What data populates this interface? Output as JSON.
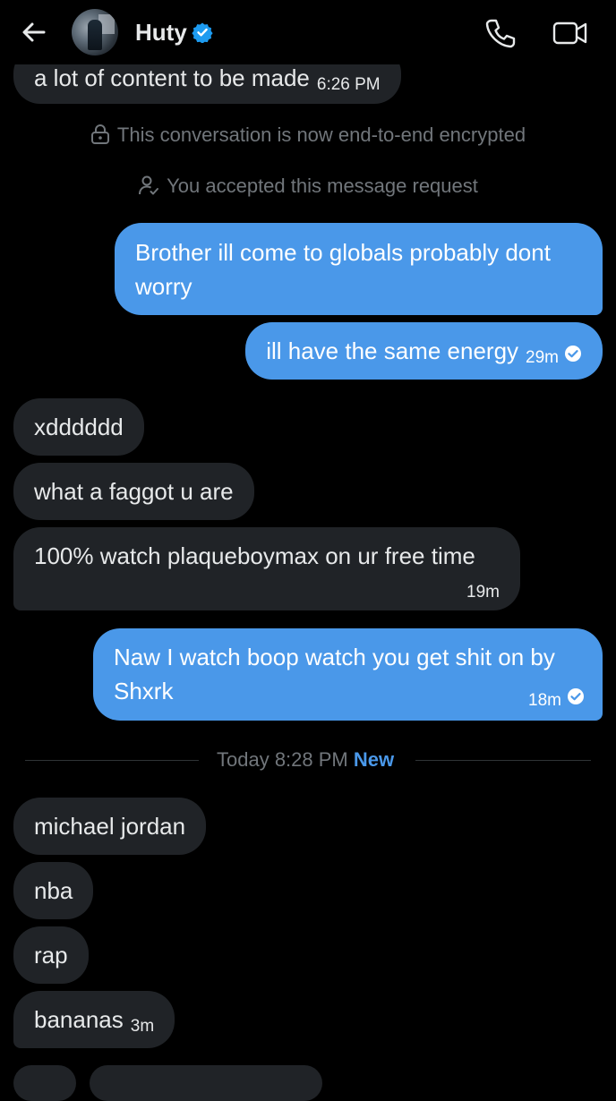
{
  "header": {
    "username": "Huty",
    "verified": true,
    "icons": [
      "back-arrow-icon",
      "verified-badge-icon",
      "phone-icon",
      "video-camera-icon"
    ]
  },
  "colors": {
    "background": "#000000",
    "incoming_bubble": "#202327",
    "outgoing_bubble": "#4a98e9",
    "muted_text": "#71767b",
    "accent": "#4a98e9"
  },
  "messages": {
    "m1": {
      "text": "a lot of content to be made",
      "time": "6:26 PM"
    },
    "sys_encrypted": "This conversation is now end-to-end encrypted",
    "sys_accepted": "You accepted this message request",
    "m2": {
      "text": "Brother ill come to globals probably dont worry"
    },
    "m3": {
      "text": "ill have the same energy",
      "time": "29m"
    },
    "m4": {
      "text": "xdddddd"
    },
    "m5": {
      "text": "what a faggot u are"
    },
    "m6": {
      "text": "100% watch plaqueboymax on ur free time",
      "time": "19m"
    },
    "m7": {
      "text": "Naw I watch boop watch you get shit on by Shxrk",
      "time": "18m"
    },
    "divider": {
      "label": "Today 8:28 PM",
      "new_label": "New"
    },
    "m8": {
      "text": "michael jordan"
    },
    "m9": {
      "text": "nba"
    },
    "m10": {
      "text": "rap"
    },
    "m11": {
      "text": "bananas",
      "time": "3m"
    }
  }
}
